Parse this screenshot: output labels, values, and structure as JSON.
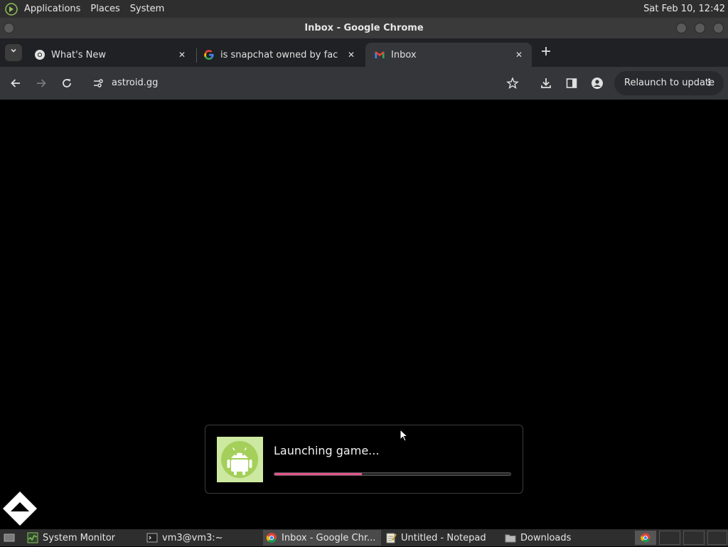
{
  "top_panel": {
    "menus": [
      "Applications",
      "Places",
      "System"
    ],
    "clock": "Sat Feb 10, 12:42"
  },
  "window": {
    "title": "Inbox - Google Chrome"
  },
  "tabs": [
    {
      "title": "What's New",
      "icon": "chrome-icon",
      "active": false
    },
    {
      "title": "is snapchat owned by facebook",
      "icon": "google-icon",
      "active": false
    },
    {
      "title": "Inbox",
      "icon": "gmail-icon",
      "active": true
    }
  ],
  "toolbar": {
    "url": "astroid.gg",
    "relaunch_label": "Relaunch to update"
  },
  "page": {
    "launch_text": "Launching game...",
    "progress": 0.37,
    "progress_color": "#e6538a"
  },
  "taskbar": {
    "tasks": [
      {
        "label": "System Monitor",
        "icon": "system-monitor-icon"
      },
      {
        "label": "vm3@vm3:~",
        "icon": "terminal-icon"
      },
      {
        "label": "Inbox - Google Chr...",
        "icon": "chrome-icon",
        "active": true
      },
      {
        "label": "Untitled - Notepad",
        "icon": "notepad-icon"
      },
      {
        "label": "Downloads",
        "icon": "folder-icon"
      }
    ]
  }
}
